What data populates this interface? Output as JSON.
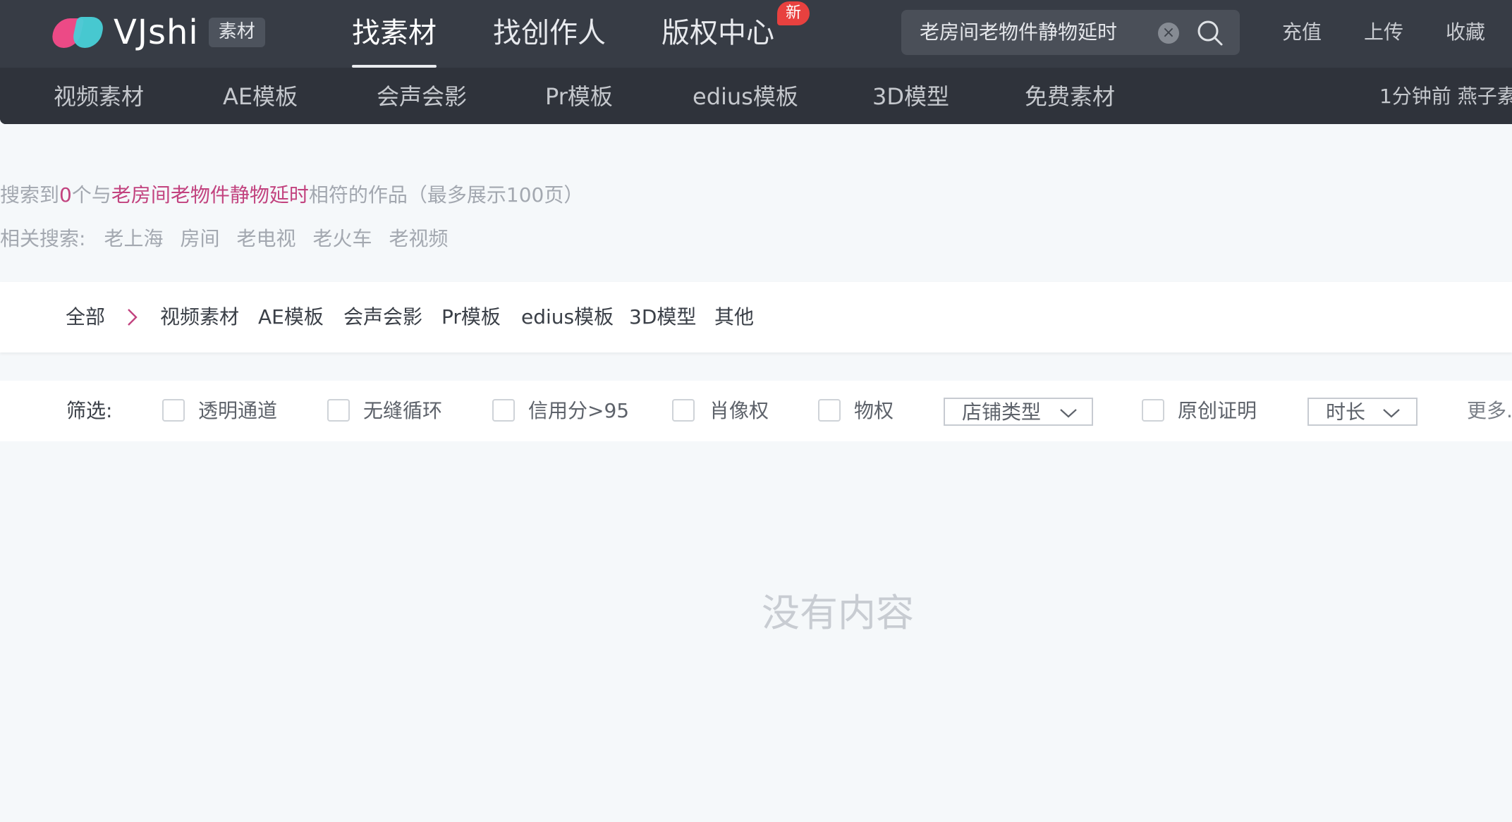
{
  "header": {
    "logo_text": "VJshi",
    "logo_badge": "素材",
    "main_tabs": [
      {
        "label": "找素材"
      },
      {
        "label": "找创作人"
      },
      {
        "label": "版权中心"
      }
    ],
    "new_badge": "新",
    "search": {
      "value": "老房间老物件静物延时"
    },
    "links": {
      "recharge": "充值",
      "upload": "上传",
      "favorites": "收藏"
    },
    "sub_nav": [
      "视频素材",
      "AE模板",
      "会声会影",
      "Pr模板",
      "edius模板",
      "3D模型",
      "免费素材"
    ],
    "ticker": "1分钟前 燕子素"
  },
  "results": {
    "prefix": "搜索到",
    "count": "0",
    "middle": "个与",
    "keyword": "老房间老物件静物延时",
    "suffix": "相符的作品（最多展示100页）",
    "related_label": "相关搜索:",
    "related": [
      "老上海",
      "房间",
      "老电视",
      "老火车",
      "老视频"
    ]
  },
  "categories": {
    "all": "全部",
    "items": [
      "视频素材",
      "AE模板",
      "会声会影",
      "Pr模板",
      "edius模板",
      "3D模型",
      "其他"
    ]
  },
  "filters": {
    "label": "筛选:",
    "checkboxes": [
      "透明通道",
      "无缝循环",
      "信用分>95",
      "肖像权",
      "物权",
      "原创证明"
    ],
    "store_type": "店铺类型",
    "duration": "时长",
    "more": "更多."
  },
  "empty_state": "没有内容",
  "colors": {
    "accent": "#c2437f",
    "header_bg": "#373c45",
    "new_badge": "#e8413f"
  }
}
